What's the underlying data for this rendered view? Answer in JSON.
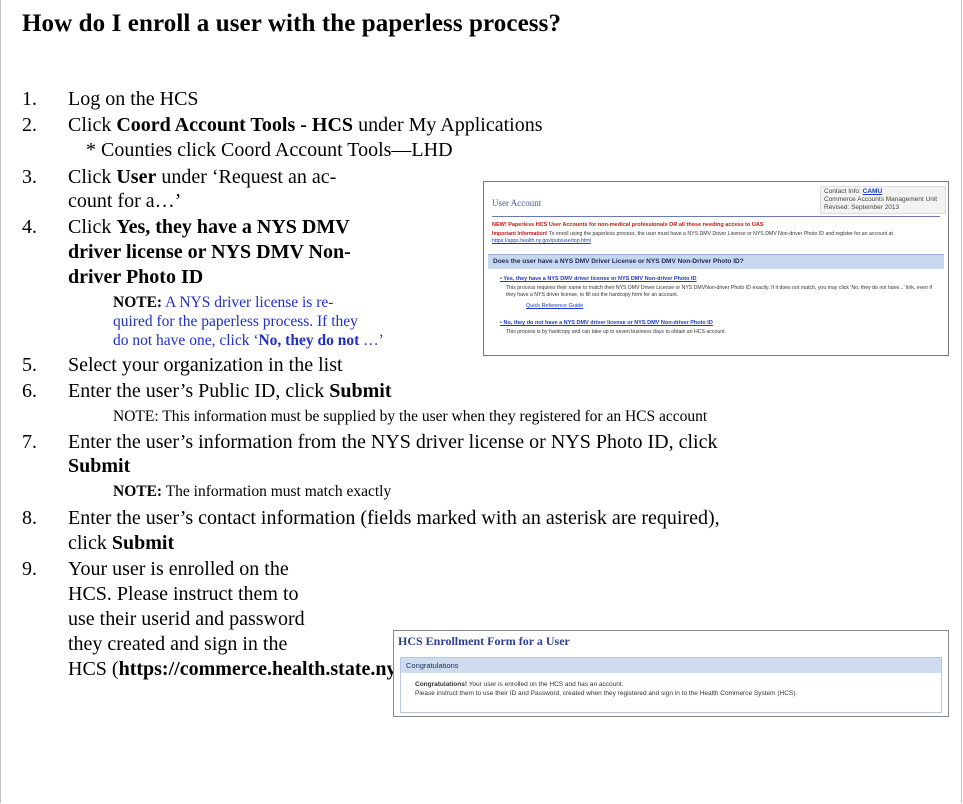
{
  "title": "How do I enroll a user with the paperless process?",
  "steps": {
    "s1": {
      "num": "1.",
      "text": "Log on the HCS"
    },
    "s2": {
      "num": "2.",
      "pre": "Click ",
      "bold": "Coord Account Tools -  HCS",
      "post": " under My Applications",
      "sub": "* Counties click Coord Account Tools—LHD"
    },
    "s3": {
      "num": "3.",
      "pre": "Click ",
      "bold": "User",
      "post": " under ‘Request an ac-",
      "line2": "count for a…’"
    },
    "s4": {
      "num": "4.",
      "pre": "Click ",
      "bold1": "Yes, they have a NYS DMV",
      "bold2": "driver license or NYS DMV Non-",
      "bold3": "driver Photo ID",
      "note_label": "NOTE:",
      "note1": " A NYS driver license is re-",
      "note2": "quired for the paperless process.  If they",
      "note3a": "do not have one, click  ‘",
      "note3b": "No, they do not",
      "note3c": " …’"
    },
    "s5": {
      "num": "5.",
      "text": "Select your organization in the list"
    },
    "s6": {
      "num": "6.",
      "pre": "Enter the user’s Public ID, click ",
      "bold": "Submit",
      "note": "NOTE:  This information must be supplied by the user when they registered for an HCS account"
    },
    "s7": {
      "num": "7.",
      "text": "Enter the user’s information from the NYS driver license or NYS Photo ID, click",
      "bold": "Submit",
      "note_label": "NOTE:",
      "note": " The information must match exactly"
    },
    "s8": {
      "num": "8.",
      "text": "Enter the user’s contact information (fields marked with an asterisk are required),",
      "pre2": "click ",
      "bold": "Submit"
    },
    "s9": {
      "num": "9.",
      "l1": "Your user is enrolled on the",
      "l2": "HCS.  Please instruct them to",
      "l3": "use their userid and password",
      "l4": "they created and sign in the",
      "l5a": "HCS (",
      "l5b": "https://commerce.health.state.ny.us",
      "l5c": ")"
    }
  },
  "screenshot1": {
    "header": "User Account",
    "contact_label": "Contact Info: ",
    "contact_link": "CAMU",
    "contact_l2": "Commerce Accounts Management Unit",
    "contact_l3": "Revised: September 2013",
    "new_notice": "NEW! Paperless HCS User Accounts for non-medical professionals OR all those needing access to UAS",
    "info_label": "Important Information!",
    "info_text": " To enroll using the paperless process, the user must have a NYS DMV Driver License or NYS DMV Non-driver Photo ID and register for an account at ",
    "info_link": "https://apps.health.ny.gov/pub/usertop.html",
    "question": "Does the user have a NYS DMV Driver License or NYS DMV Non-Driver Photo ID?",
    "yes_link": "Yes, they have a NYS DMV driver license or NYS DMV Non-driver Photo ID",
    "yes_desc": "This process requires their name to match their NYS DMV Driver License or NYS DMVNon-driver Photo ID exactly. If it does not match, you may click 'No, they do not have...' link, even if they have a NYS driver license, to fill out the hardcopy form for an account.",
    "qrg_link": "Quick Reference Guide",
    "no_link": "No, they do not have a NYS DMV driver license or NYS DMV Non-driver Photo ID",
    "no_desc": "This process is by hardcopy and can take up to seven business days to obtain an HCS account."
  },
  "screenshot2": {
    "header": "HCS Enrollment Form for a User",
    "bar": "Congratulations",
    "msg_bold": "Congratulations!",
    "msg1": " Your user is enrolled on the HCS and has an account.",
    "msg2": "Please instruct them to use their ID and Password, created when they registered and sign in to the Health Commerce System (HCS)."
  }
}
